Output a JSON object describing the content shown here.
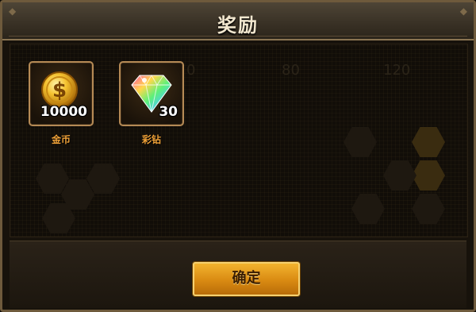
{
  "dialog": {
    "title": "奖励",
    "confirm_label": "确定"
  },
  "background_numbers": [
    "0",
    "80",
    "120"
  ],
  "rewards": [
    {
      "icon": "gold-coin-icon",
      "quantity": "10000",
      "name": "金币"
    },
    {
      "icon": "rainbow-diamond-icon",
      "quantity": "30",
      "name": "彩钻"
    }
  ],
  "colors": {
    "title_text": "#f2e7cf",
    "item_name": "#f0a238",
    "item_border": "#b58a55",
    "button_gold": "#d98a12"
  }
}
